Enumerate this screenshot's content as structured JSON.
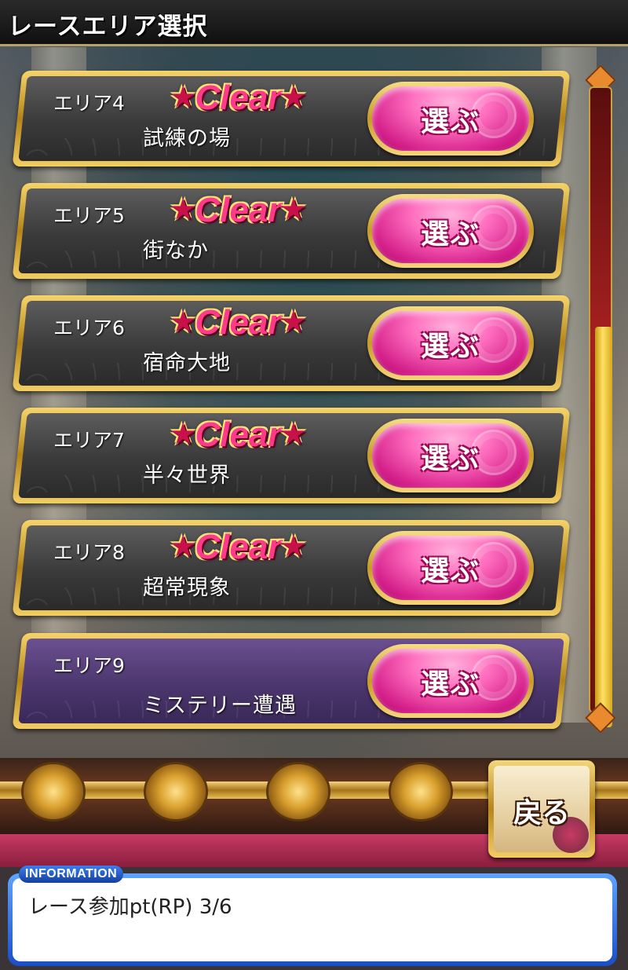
{
  "header": {
    "title": "レースエリア選択"
  },
  "areas": [
    {
      "area": "エリア4",
      "name": "試練の場",
      "status": "Clear",
      "button": "選ぶ"
    },
    {
      "area": "エリア5",
      "name": "街なか",
      "status": "Clear",
      "button": "選ぶ"
    },
    {
      "area": "エリア6",
      "name": "宿命大地",
      "status": "Clear",
      "button": "選ぶ"
    },
    {
      "area": "エリア7",
      "name": "半々世界",
      "status": "Clear",
      "button": "選ぶ"
    },
    {
      "area": "エリア8",
      "name": "超常現象",
      "status": "Clear",
      "button": "選ぶ"
    },
    {
      "area": "エリア9",
      "name": "ミステリー遭遇",
      "status": "",
      "button": "選ぶ"
    }
  ],
  "star_glyph": "★",
  "back_button": {
    "label": "戻る"
  },
  "information": {
    "tag": "INFORMATION",
    "text": "レース参加pt(RP) 3/6"
  },
  "scrollbar": {
    "position_fraction": 1.0
  },
  "colors": {
    "clear_text": "#ff3a8a",
    "button_pink": "#ff6fbf",
    "gold": "#f1cd62",
    "purple_card": "#4c376e"
  }
}
